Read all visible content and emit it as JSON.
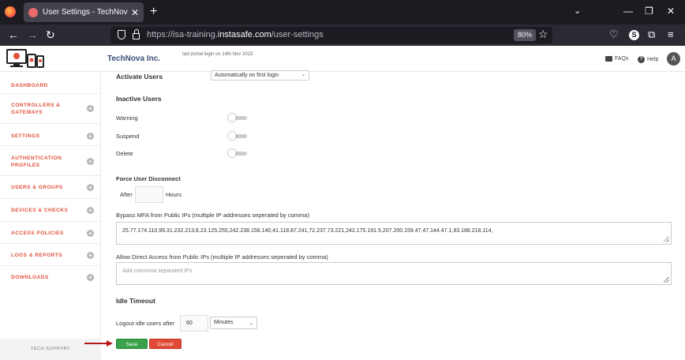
{
  "browser": {
    "tab_title": "User Settings - TechNova Inc. | I",
    "url_prefix": "https://isa-training.",
    "url_domain": "instasafe.com",
    "url_path": "/user-settings",
    "zoom": "80%",
    "account_badge": "S"
  },
  "header": {
    "brand": "TechNova Inc.",
    "last_login": "last portal login on 14th Nov 2023",
    "faqs": "FAQs",
    "help": "Help",
    "avatar_initial": "A"
  },
  "sidebar": {
    "items": [
      {
        "label": "DASHBOARD",
        "has_plus": false
      },
      {
        "label": "CONTROLLERS & GATEWAYS",
        "has_plus": true
      },
      {
        "label": "SETTINGS",
        "has_plus": true
      },
      {
        "label": "AUTHENTICATION PROFILES",
        "has_plus": true
      },
      {
        "label": "USERS & GROUPS",
        "has_plus": true
      },
      {
        "label": "DEVICES & CHECKS",
        "has_plus": true
      },
      {
        "label": "ACCESS POLICIES",
        "has_plus": true
      },
      {
        "label": "LOGS & REPORTS",
        "has_plus": true
      },
      {
        "label": "DOWNLOADS",
        "has_plus": true
      }
    ],
    "tech_support": "TECH SUPPORT"
  },
  "form": {
    "activate_users_label": "Activate Users",
    "activate_users_value": "Automatically on first login",
    "inactive_users_heading": "Inactive Users",
    "warning_label": "Warning",
    "suspend_label": "Suspend",
    "delete_label": "Delete",
    "toggles": {
      "warning": false,
      "suspend": false,
      "delete": false
    },
    "force_disconnect_heading": "Force User Disconnect",
    "after_label": "After",
    "hours_label": "Hours",
    "hours_value": "",
    "bypass_mfa_label": "Bypass MFA from Public IPs (multiple IP addresses seperated by comma)",
    "bypass_mfa_value": "25.77.174.110,99.31.232.213,8.23.125.255,242.238.156.140,41.118.87.241,72.237.73.221,242.175.191.5,207.200.159.47,47.144.47.1,93.188.218.114,",
    "direct_access_label": "Allow Direct Access from Public IPs (multiple IP addresses seperated by comma)",
    "direct_access_placeholder": "Add commma separated IPs",
    "idle_timeout_heading": "Idle Timeout",
    "logout_idle_label": "Logout idle users after",
    "idle_value": "60",
    "idle_unit": "Minutes",
    "save_label": "Save",
    "cancel_label": "Cancel"
  },
  "colors": {
    "sidebar_accent": "#e0523c",
    "save": "#3aa14a",
    "cancel": "#e04a35",
    "annotation_arrow": "#b01a1a"
  }
}
